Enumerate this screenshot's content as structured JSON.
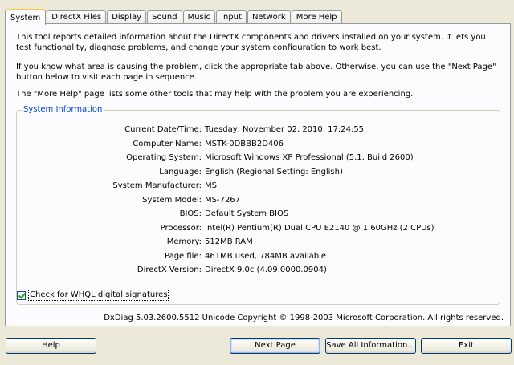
{
  "tabs": [
    {
      "label": "System",
      "active": true
    },
    {
      "label": "DirectX Files",
      "active": false
    },
    {
      "label": "Display",
      "active": false
    },
    {
      "label": "Sound",
      "active": false
    },
    {
      "label": "Music",
      "active": false
    },
    {
      "label": "Input",
      "active": false
    },
    {
      "label": "Network",
      "active": false
    },
    {
      "label": "More Help",
      "active": false
    }
  ],
  "intro": {
    "p1": "This tool reports detailed information about the DirectX components and drivers installed on your system.  It lets you test functionality, diagnose problems, and change your system configuration to work best.",
    "p2": "If you know what area is causing the problem, click the appropriate tab above.  Otherwise, you can use the \"Next Page\" button below to visit each page in sequence.",
    "p3": "The \"More Help\" page lists some other tools that may help with the problem you are experiencing."
  },
  "system_info": {
    "title": "System Information",
    "rows": [
      {
        "label": "Current Date/Time:",
        "value": "Tuesday, November 02, 2010, 17:24:55"
      },
      {
        "label": "Computer Name:",
        "value": "MSTK-0DBBB2D406"
      },
      {
        "label": "Operating System:",
        "value": "Microsoft Windows XP Professional (5.1, Build 2600)"
      },
      {
        "label": "Language:",
        "value": "English (Regional Setting: English)"
      },
      {
        "label": "System Manufacturer:",
        "value": "MSI"
      },
      {
        "label": "System Model:",
        "value": "MS-7267"
      },
      {
        "label": "BIOS:",
        "value": "Default System BIOS"
      },
      {
        "label": "Processor:",
        "value": "Intel(R) Pentium(R) Dual  CPU  E2140  @ 1.60GHz (2 CPUs)"
      },
      {
        "label": "Memory:",
        "value": "512MB RAM"
      },
      {
        "label": "Page file:",
        "value": "461MB used, 784MB available"
      },
      {
        "label": "DirectX Version:",
        "value": "DirectX 9.0c (4.09.0000.0904)"
      }
    ]
  },
  "whql": {
    "label": "Check for WHQL digital signatures",
    "checked": true
  },
  "copyright": "DxDiag 5.03.2600.5512 Unicode  Copyright © 1998-2003 Microsoft Corporation.  All rights reserved.",
  "buttons": {
    "help": "Help",
    "next": "Next Page",
    "save": "Save All Information...",
    "exit": "Exit"
  }
}
